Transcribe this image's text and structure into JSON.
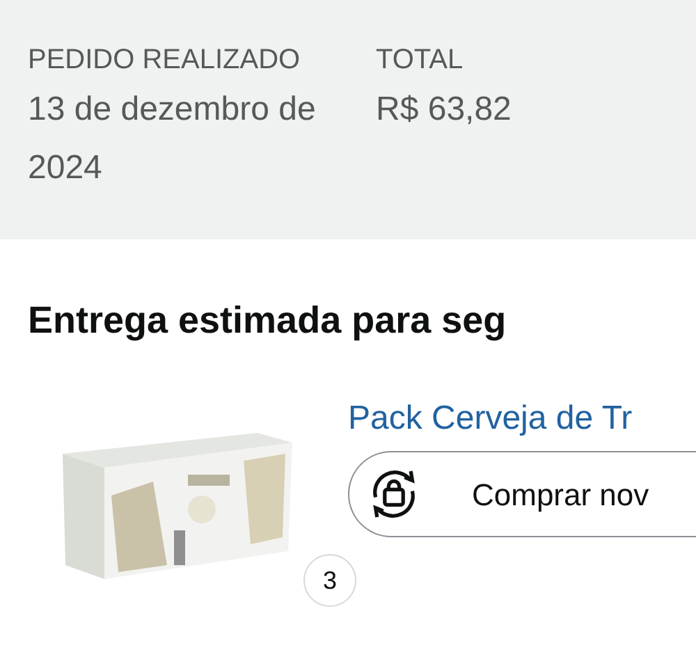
{
  "order_summary": [
    {
      "label": "PEDIDO REALIZADO",
      "value": "13 de dezembro de 2024"
    },
    {
      "label": "TOTAL",
      "value": "R$ 63,82"
    }
  ],
  "delivery": {
    "heading": "Entrega estimada para seg"
  },
  "item": {
    "quantity": "3",
    "title": "Pack Cerveja de Tr",
    "buy_again": "Comprar nov"
  }
}
